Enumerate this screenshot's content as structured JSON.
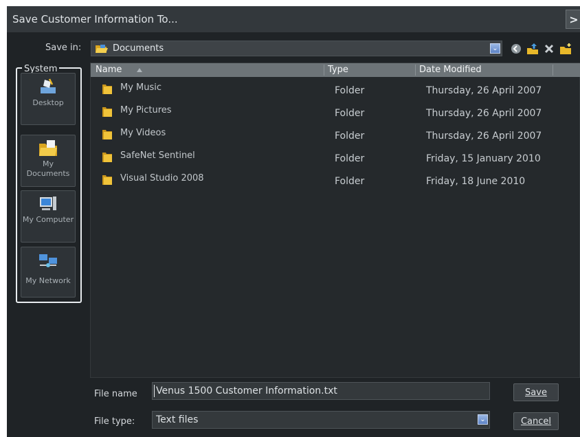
{
  "window": {
    "title": "Save Customer Information To...",
    "close_glyph": ">"
  },
  "toolbar": {
    "save_in_label": "Save in:",
    "save_in_value": "Documents",
    "dropdown_glyph": "⌄",
    "icons": [
      "back-icon",
      "up-folder-icon",
      "delete-icon",
      "new-folder-icon"
    ]
  },
  "places": {
    "group_label": "System",
    "items": [
      {
        "label": "Desktop",
        "icon": "desktop-icon"
      },
      {
        "label": "My Documents",
        "icon": "my-documents-icon"
      },
      {
        "label": "My Computer",
        "icon": "my-computer-icon"
      },
      {
        "label": "My Network",
        "icon": "my-network-icon"
      }
    ]
  },
  "file_list": {
    "columns": {
      "name": "Name",
      "type": "Type",
      "date": "Date Modified"
    },
    "rows": [
      {
        "name": "My Music",
        "type": "Folder",
        "date": "Thursday, 26 April 2007"
      },
      {
        "name": "My Pictures",
        "type": "Folder",
        "date": "Thursday, 26 April 2007"
      },
      {
        "name": "My Videos",
        "type": "Folder",
        "date": "Thursday, 26 April 2007"
      },
      {
        "name": "SafeNet Sentinel",
        "type": "Folder",
        "date": "Friday, 15 January 2010"
      },
      {
        "name": "Visual Studio 2008",
        "type": "Folder",
        "date": "Friday, 18 June 2010"
      }
    ]
  },
  "form": {
    "file_name_label": "File name",
    "file_name_value": "Venus 1500 Customer Information.txt",
    "file_type_label": "File type:",
    "file_type_value": "Text files",
    "save_label": "Save",
    "cancel_label": "Cancel"
  },
  "colors": {
    "dialog_bg": "#1f2326",
    "header_bg": "#6d7478",
    "folder": "#e8b82a",
    "accent": "#6f93d3"
  }
}
